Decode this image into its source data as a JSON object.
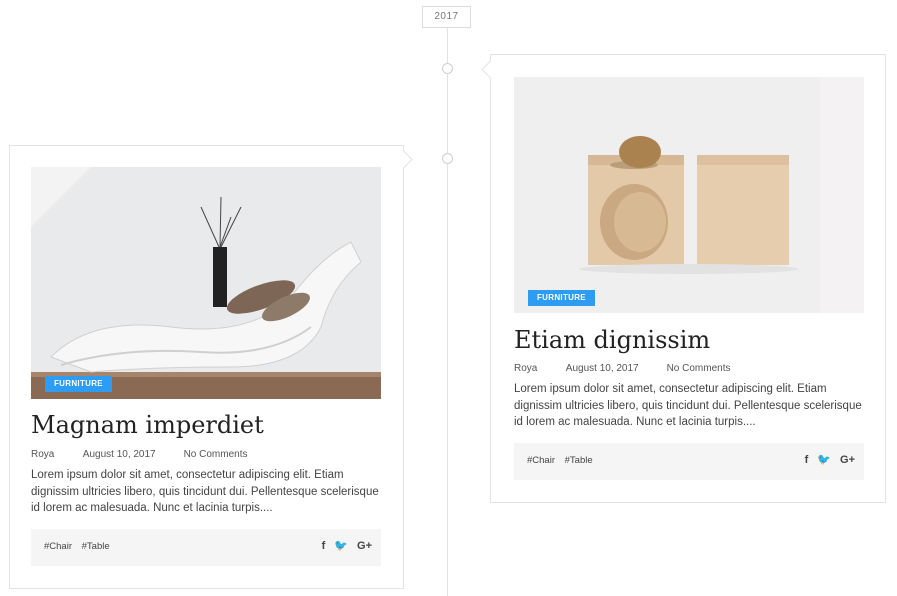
{
  "timeline": {
    "year": "2017"
  },
  "posts": [
    {
      "category": "FURNITURE",
      "title": "Magnam imperdiet",
      "author": "Roya",
      "date": "August 10, 2017",
      "comments": "No Comments",
      "excerpt": "Lorem ipsum dolor sit amet, consectetur adipiscing elit. Etiam dignissim ultricies libero, quis tincidunt dui. Pellentesque scelerisque id lorem ac malesuada. Nunc et lacinia turpis....",
      "tags": [
        "#Chair",
        "#Table"
      ],
      "social": [
        "f",
        "🐦",
        "G+"
      ]
    },
    {
      "category": "FURNITURE",
      "title": "Etiam dignissim",
      "author": "Roya",
      "date": "August 10, 2017",
      "comments": "No Comments",
      "excerpt": "Lorem ipsum dolor sit amet, consectetur adipiscing elit. Etiam dignissim ultricies libero, quis tincidunt dui. Pellentesque scelerisque id lorem ac malesuada. Nunc et lacinia turpis....",
      "tags": [
        "#Chair",
        "#Table"
      ],
      "social": [
        "f",
        "🐦",
        "G+"
      ]
    }
  ],
  "icons": {
    "facebook": "facebook-icon",
    "twitter": "twitter-icon",
    "google_plus": "google-plus-icon"
  },
  "colors": {
    "accent": "#2e9cf2",
    "footer_bg": "#f5f5f5"
  }
}
